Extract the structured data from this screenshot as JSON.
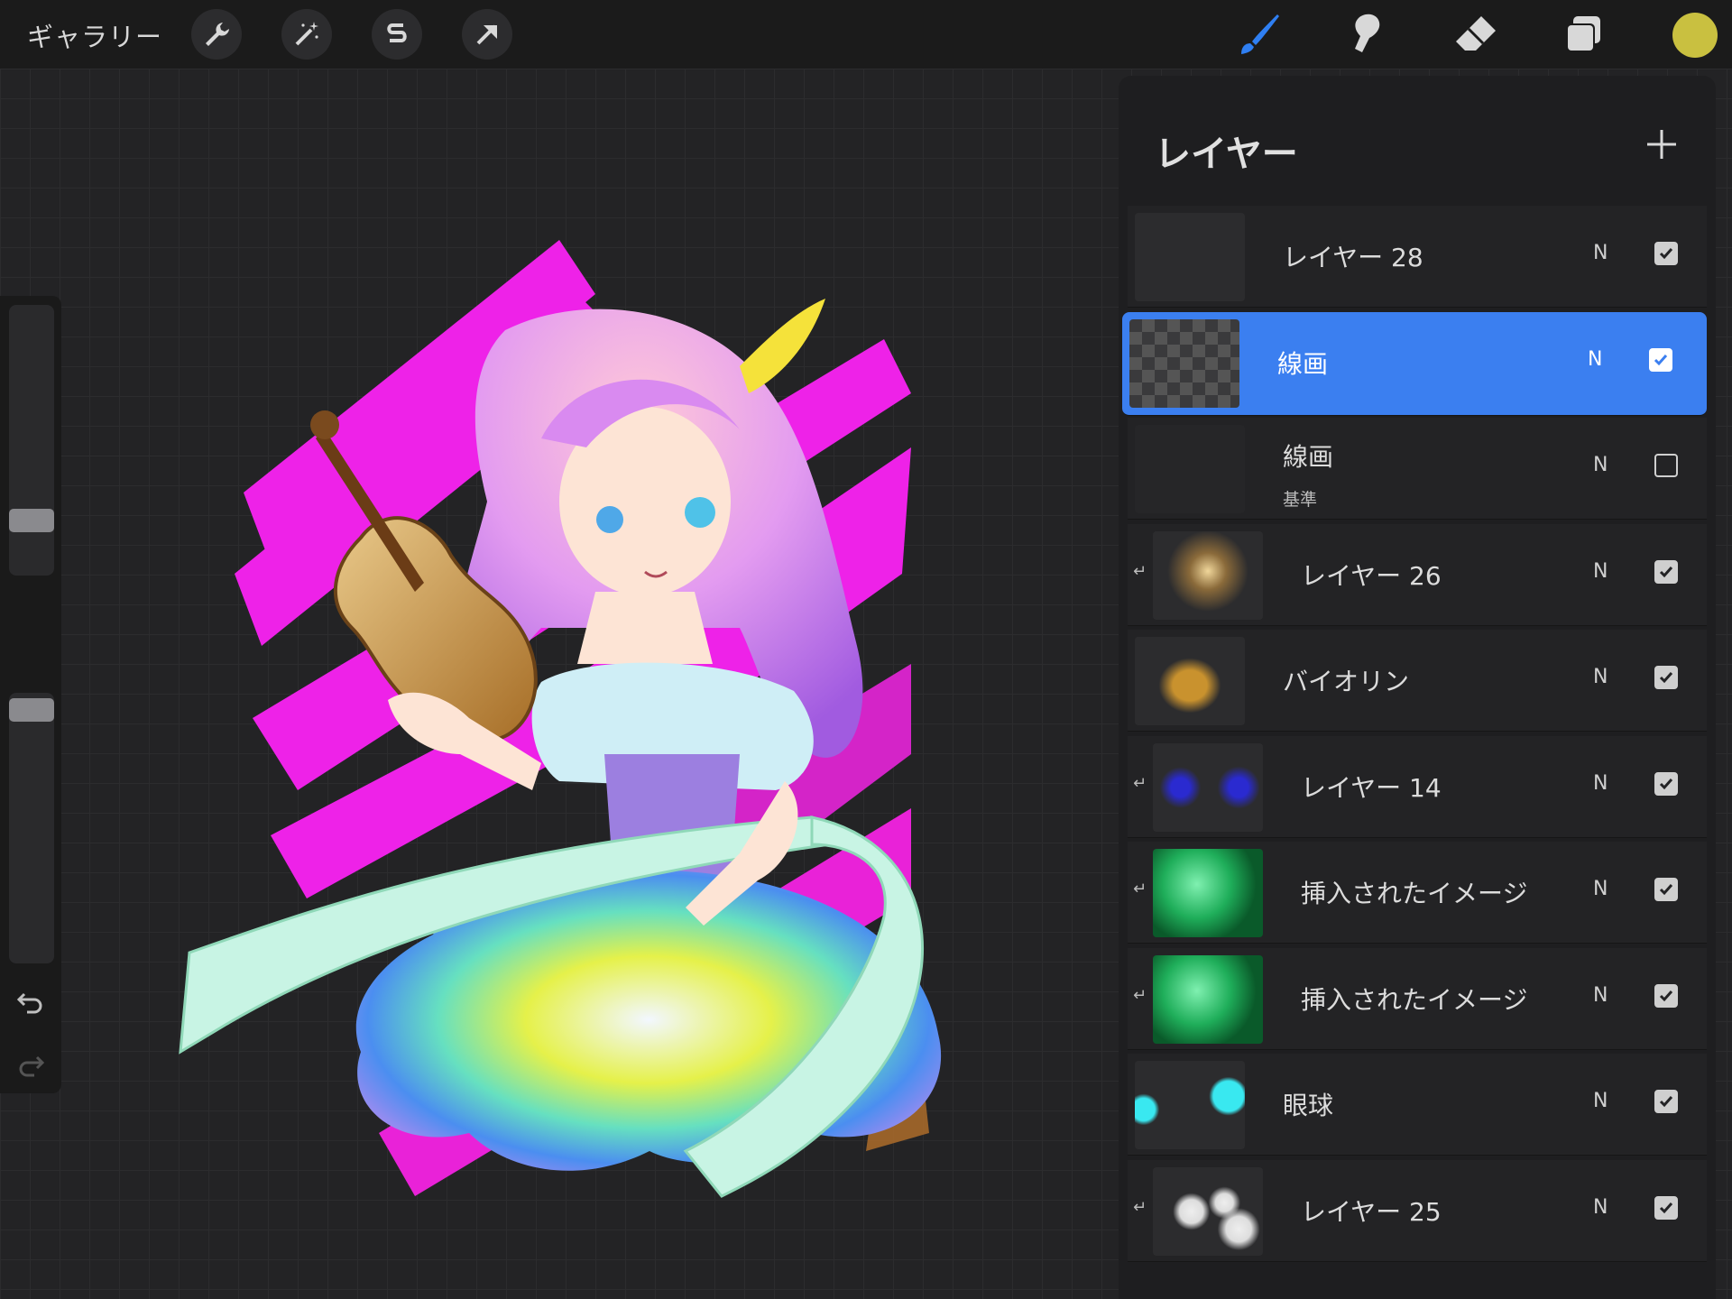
{
  "toolbar": {
    "gallery_label": "ギャラリー",
    "left_tools": [
      "wrench-icon",
      "magic-wand-icon",
      "s-curve-icon",
      "arrow-icon"
    ],
    "right_tools": [
      "brush-icon",
      "smudge-icon",
      "eraser-icon",
      "layers-icon"
    ],
    "active_tool": "brush",
    "color": "#c9c040"
  },
  "sidebar": {
    "size_level": 0.2,
    "opacity_level": 0.85
  },
  "layers_panel": {
    "title": "レイヤー",
    "add_icon": "plus-icon",
    "layers": [
      {
        "name": "レイヤー 28",
        "sub": "",
        "mode": "N",
        "visible": true,
        "clipped": false,
        "selected": false,
        "thumb": "empty"
      },
      {
        "name": "線画",
        "sub": "",
        "mode": "N",
        "visible": true,
        "clipped": false,
        "selected": true,
        "thumb": "checker"
      },
      {
        "name": "線画",
        "sub": "基準",
        "mode": "N",
        "visible": false,
        "clipped": false,
        "selected": false,
        "thumb": "sketch"
      },
      {
        "name": "レイヤー 26",
        "sub": "",
        "mode": "N",
        "visible": true,
        "clipped": true,
        "selected": false,
        "thumb": "glow"
      },
      {
        "name": "バイオリン",
        "sub": "",
        "mode": "N",
        "visible": true,
        "clipped": false,
        "selected": false,
        "thumb": "violin"
      },
      {
        "name": "レイヤー 14",
        "sub": "",
        "mode": "N",
        "visible": true,
        "clipped": true,
        "selected": false,
        "thumb": "eyes-dark"
      },
      {
        "name": "挿入されたイメージ",
        "sub": "",
        "mode": "N",
        "visible": true,
        "clipped": true,
        "selected": false,
        "thumb": "green"
      },
      {
        "name": "挿入されたイメージ",
        "sub": "",
        "mode": "N",
        "visible": true,
        "clipped": true,
        "selected": false,
        "thumb": "green"
      },
      {
        "name": "眼球",
        "sub": "",
        "mode": "N",
        "visible": true,
        "clipped": false,
        "selected": false,
        "thumb": "eyeballs"
      },
      {
        "name": "レイヤー 25",
        "sub": "",
        "mode": "N",
        "visible": true,
        "clipped": true,
        "selected": false,
        "thumb": "blobs"
      }
    ]
  },
  "colors": {
    "accent": "#3b7ff0",
    "magenta": "#ee22e8",
    "ribbon": "#c8f4e4"
  }
}
